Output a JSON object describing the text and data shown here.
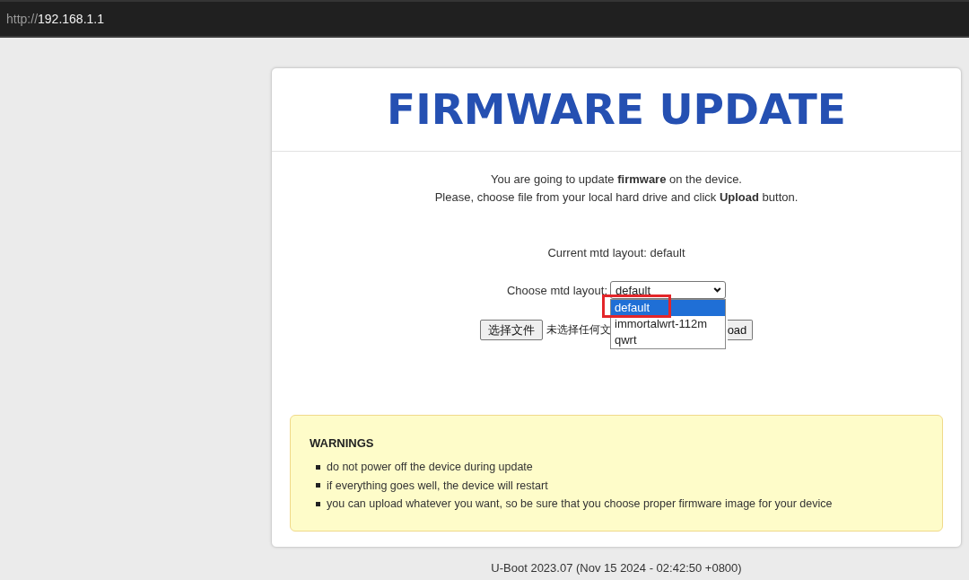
{
  "address_bar": {
    "scheme": "http://",
    "host": "192.168.1.1"
  },
  "page": {
    "title": "FIRMWARE UPDATE",
    "intro": [
      "You are going to update **firmware** on the device.",
      "Please, choose file from your local hard drive and click **Upload** button."
    ],
    "current_layout": "Current mtd layout: default",
    "layout_select": {
      "label": "Choose mtd layout:",
      "value": "default",
      "expanded": true,
      "options": [
        {
          "label": "default",
          "selected": true,
          "marked": true
        },
        {
          "label": "immortalwrt-112m",
          "selected": false,
          "marked": false
        },
        {
          "label": "qwrt",
          "selected": false,
          "marked": false
        }
      ]
    },
    "file_picker": {
      "button": "选择文件",
      "status": "未选择任何文"
    },
    "upload_button": {
      "label": "oad"
    },
    "warnings": {
      "title": "WARNINGS",
      "items": [
        "do not power off the device during update",
        "if everything goes well, the device will restart",
        "you can upload whatever you want, so be sure that you choose proper firmware image for your device"
      ]
    }
  },
  "footer": "U-Boot 2023.07 (Nov 15 2024 - 02:42:50 +0800)"
}
